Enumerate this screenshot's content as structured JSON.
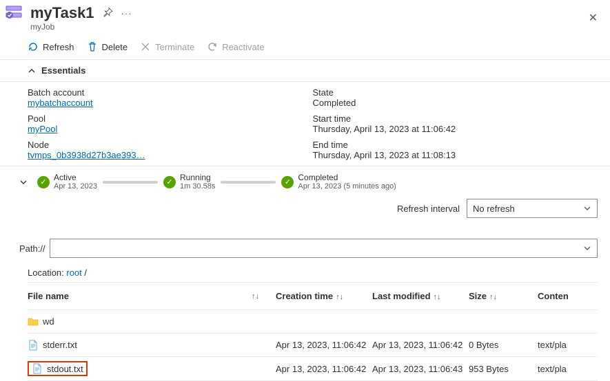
{
  "header": {
    "title": "myTask1",
    "subtitle": "myJob"
  },
  "toolbar": {
    "refresh": "Refresh",
    "delete": "Delete",
    "terminate": "Terminate",
    "reactivate": "Reactivate"
  },
  "essentials": {
    "header": "Essentials",
    "left": {
      "batch_label": "Batch account",
      "batch_value": "mybatchaccount",
      "pool_label": "Pool",
      "pool_value": "myPool",
      "node_label": "Node",
      "node_value": "tvmps_0b3938d27b3ae393…"
    },
    "right": {
      "state_label": "State",
      "state_value": "Completed",
      "start_label": "Start time",
      "start_value": "Thursday, April 13, 2023 at 11:06:42",
      "end_label": "End time",
      "end_value": "Thursday, April 13, 2023 at 11:08:13"
    }
  },
  "timeline": {
    "active": {
      "title": "Active",
      "sub": "Apr 13, 2023"
    },
    "running": {
      "title": "Running",
      "sub": "1m 30.58s"
    },
    "completed": {
      "title": "Completed",
      "sub": "Apr 13, 2023 (5 minutes ago)"
    }
  },
  "refresh_interval": {
    "label": "Refresh interval",
    "value": "No refresh"
  },
  "path": {
    "label": "Path://",
    "value": ""
  },
  "breadcrumb": {
    "prefix": "Location: ",
    "root": "root",
    "sep": " /"
  },
  "table": {
    "headers": {
      "name": "File name",
      "ctime": "Creation time",
      "mtime": "Last modified",
      "size": "Size",
      "content": "Conten"
    },
    "rows": [
      {
        "kind": "folder",
        "name": "wd",
        "ctime": "",
        "mtime": "",
        "size": "",
        "content": "",
        "highlight": false
      },
      {
        "kind": "file",
        "name": "stderr.txt",
        "ctime": "Apr 13, 2023, 11:06:42",
        "mtime": "Apr 13, 2023, 11:06:42",
        "size": "0 Bytes",
        "content": "text/pla",
        "highlight": false
      },
      {
        "kind": "file",
        "name": "stdout.txt",
        "ctime": "Apr 13, 2023, 11:06:42",
        "mtime": "Apr 13, 2023, 11:06:43",
        "size": "953 Bytes",
        "content": "text/pla",
        "highlight": true
      }
    ]
  }
}
